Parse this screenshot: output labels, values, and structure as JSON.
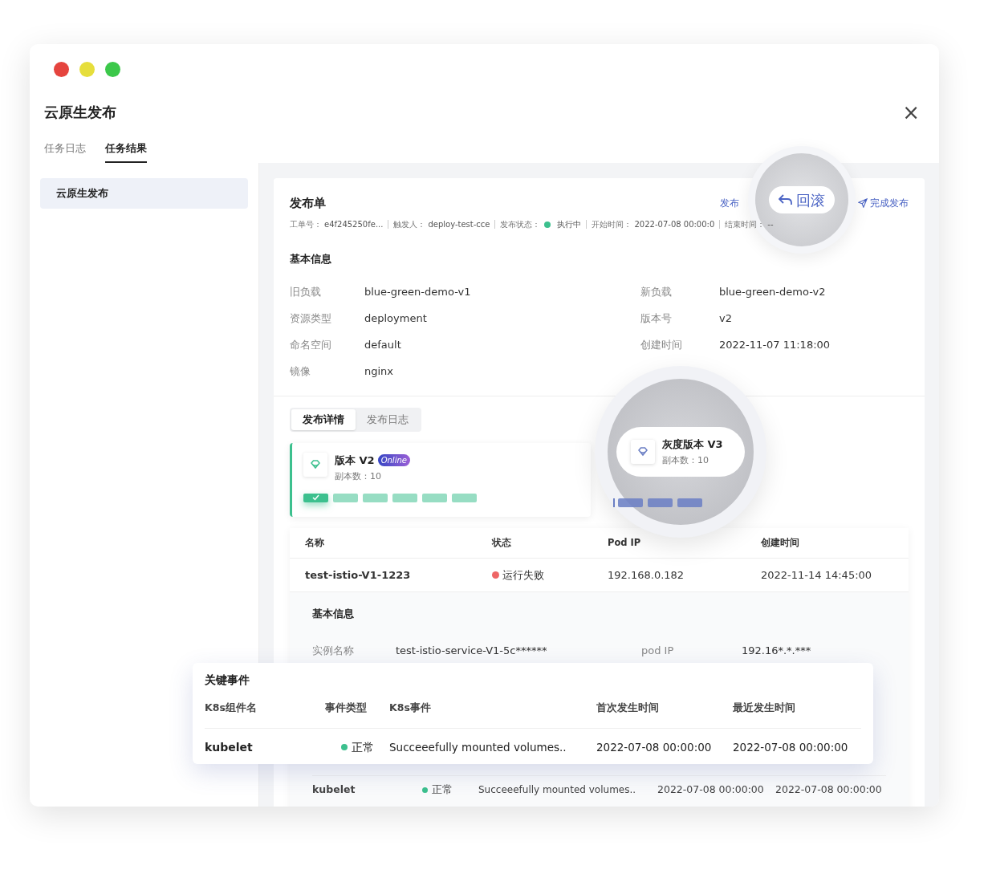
{
  "window": {
    "title": "云原生发布",
    "close": "×"
  },
  "tabs": [
    {
      "label": "任务日志",
      "selected": false
    },
    {
      "label": "任务结果",
      "selected": true
    }
  ],
  "sidebar": {
    "items": [
      {
        "label": "云原生发布",
        "selected": true
      }
    ]
  },
  "order": {
    "title": "发布单",
    "actions": [
      {
        "label": "发布",
        "kind": "link"
      },
      {
        "label": "完成发布",
        "kind": "send"
      }
    ],
    "meta": [
      {
        "label": "工单号：",
        "value": "e4f245250fe..."
      },
      {
        "label": "触发人：",
        "value": "deploy-test-cce"
      },
      {
        "label": "发布状态：",
        "value": "执行中",
        "color": "#3cc08e"
      },
      {
        "label": "开始时间：",
        "value": "2022-07-08 00:00:0"
      },
      {
        "label": "结束时间：",
        "value": "--"
      }
    ]
  },
  "basic_info": {
    "title": "基本信息",
    "fields": [
      {
        "label": "旧负载",
        "value": "blue-green-demo-v1"
      },
      {
        "label": "新负载",
        "value": "blue-green-demo-v2"
      },
      {
        "label": "资源类型",
        "value": "deployment"
      },
      {
        "label": "版本号",
        "value": "v2"
      },
      {
        "label": "命名空间",
        "value": "default"
      },
      {
        "label": "创建时间",
        "value": "2022-11-07 11:18:00"
      },
      {
        "label": "镜像",
        "value": "nginx"
      }
    ]
  },
  "sub_tabs": [
    {
      "label": "发布详情",
      "selected": true
    },
    {
      "label": "发布日志",
      "selected": false
    }
  ],
  "versions": [
    {
      "title": "版本 V2",
      "badge": "Online",
      "replicas_label": "副本数：",
      "replicas": "10",
      "color": "#3cc08e",
      "segments": [
        {
          "current": true
        },
        {
          "current": false
        },
        {
          "current": false
        },
        {
          "current": false
        },
        {
          "current": false
        },
        {
          "current": false
        }
      ]
    },
    {
      "title": "灰度版本 V3",
      "replicas_label": "副本数：",
      "replicas": "10",
      "color": "#6b7fc4",
      "segments": [
        {
          "current": false
        },
        {
          "current": false
        },
        {
          "current": false
        }
      ]
    }
  ],
  "pods": {
    "columns": [
      "名称",
      "状态",
      "Pod IP",
      "创建时间"
    ],
    "rows": [
      {
        "name": "test-istio-V1-1223",
        "status": "运行失败",
        "color": "#ee6666",
        "ip": "192.168.0.182",
        "created": "2022-11-14 14:45:00"
      }
    ],
    "detail": {
      "title": "基本信息",
      "fields": [
        {
          "label": "实例名称",
          "value": "test-istio-service-V1-5c******"
        },
        {
          "label": "pod IP",
          "value": "192.16*.*.***"
        }
      ]
    }
  },
  "events_rows": [
    {
      "component": "kubelet",
      "type": "正常",
      "color": "#3cc08e",
      "event": "Succeeefully mounted volumes..",
      "first": "2022-07-08 00:00:00",
      "last": "2022-07-08 00:00:00"
    }
  ],
  "rollback": {
    "label": "回滚"
  },
  "key_events": {
    "title": "关键事件",
    "columns": [
      "K8s组件名",
      "事件类型",
      "K8s事件",
      "首次发生时间",
      "最近发生时间"
    ],
    "rows": [
      {
        "component": "kubelet",
        "type": "正常",
        "color": "#3cc08e",
        "event": "Succeeefully mounted volumes..",
        "first": "2022-07-08 00:00:00",
        "last": "2022-07-08 00:00:00"
      }
    ]
  }
}
